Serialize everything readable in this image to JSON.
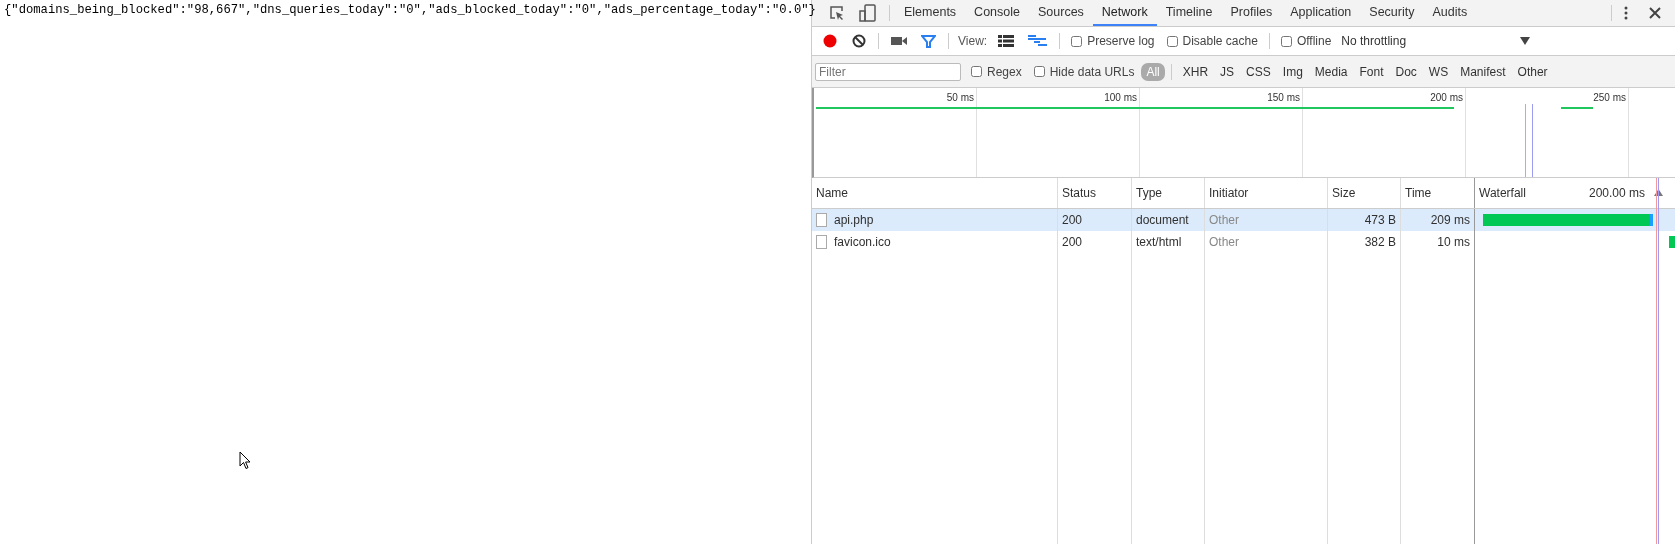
{
  "page_text": "{\"domains_being_blocked\":\"98,667\",\"dns_queries_today\":\"0\",\"ads_blocked_today\":\"0\",\"ads_percentage_today\":\"0.0\"}",
  "devtools": {
    "tabs": [
      {
        "label": "Elements",
        "selected": false
      },
      {
        "label": "Console",
        "selected": false
      },
      {
        "label": "Sources",
        "selected": false
      },
      {
        "label": "Network",
        "selected": true
      },
      {
        "label": "Timeline",
        "selected": false
      },
      {
        "label": "Profiles",
        "selected": false
      },
      {
        "label": "Application",
        "selected": false
      },
      {
        "label": "Security",
        "selected": false
      },
      {
        "label": "Audits",
        "selected": false
      }
    ],
    "toolbar": {
      "recording": true,
      "view_label": "View:",
      "options": [
        {
          "label": "Preserve log",
          "checked": false
        },
        {
          "label": "Disable cache",
          "checked": false
        },
        {
          "label": "Offline",
          "checked": false
        }
      ],
      "throttling": "No throttling"
    },
    "filter": {
      "placeholder": "Filter",
      "options": [
        {
          "label": "Regex",
          "checked": false
        },
        {
          "label": "Hide data URLs",
          "checked": false
        }
      ],
      "types": [
        {
          "label": "All",
          "selected": true
        },
        {
          "label": "XHR",
          "selected": false
        },
        {
          "label": "JS",
          "selected": false
        },
        {
          "label": "CSS",
          "selected": false
        },
        {
          "label": "Img",
          "selected": false
        },
        {
          "label": "Media",
          "selected": false
        },
        {
          "label": "Font",
          "selected": false
        },
        {
          "label": "Doc",
          "selected": false
        },
        {
          "label": "WS",
          "selected": false
        },
        {
          "label": "Manifest",
          "selected": false
        },
        {
          "label": "Other",
          "selected": false
        }
      ]
    },
    "overview_ticks": [
      "50 ms",
      "100 ms",
      "150 ms",
      "200 ms",
      "250 ms"
    ],
    "table": {
      "columns": [
        "Name",
        "Status",
        "Type",
        "Initiator",
        "Size",
        "Time",
        "Waterfall"
      ],
      "waterfall_scale": "200.00 ms",
      "rows": [
        {
          "name": "api.php",
          "status": "200",
          "type": "document",
          "initiator": "Other",
          "size": "473 B",
          "time": "209 ms",
          "selected": true
        },
        {
          "name": "favicon.ico",
          "status": "200",
          "type": "text/html",
          "initiator": "Other",
          "size": "382 B",
          "time": "10 ms",
          "selected": false
        }
      ]
    }
  }
}
